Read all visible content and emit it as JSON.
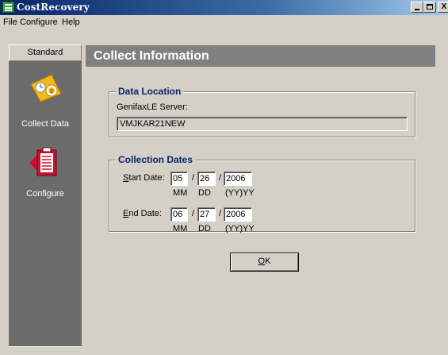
{
  "window": {
    "title": "CostRecovery",
    "controls": {
      "minimize": "_",
      "maximize": "□",
      "close": "X"
    }
  },
  "menu": {
    "items": [
      "File",
      "Configure",
      "Help"
    ]
  },
  "sidebar": {
    "tab": "Standard",
    "items": [
      {
        "label": "Collect Data",
        "icon": "collect-data-icon"
      },
      {
        "label": "Configure",
        "icon": "configure-icon"
      }
    ]
  },
  "main": {
    "title": "Collect Information",
    "data_location": {
      "title": "Data Location",
      "server_label": "GenifaxLE Server:",
      "server_value": "VMJKAR21NEW"
    },
    "collection_dates": {
      "title": "Collection Dates",
      "start_label_prefix": "S",
      "start_label_rest": "tart Date:",
      "start": {
        "mm": "05",
        "dd": "26",
        "yyyy": "2006"
      },
      "end_label_prefix": "E",
      "end_label_rest": "nd Date:",
      "end": {
        "mm": "06",
        "dd": "27",
        "yyyy": "2006"
      },
      "format": {
        "mm": "MM",
        "dd": "DD",
        "yyyy": "(YY)YY"
      },
      "separator": "/"
    },
    "ok_prefix": "O",
    "ok_rest": "K"
  },
  "colors": {
    "title_bar": "#0a246a",
    "sidebar": "#6b6b6b",
    "header": "#808080",
    "group_title": "#0a246a"
  }
}
